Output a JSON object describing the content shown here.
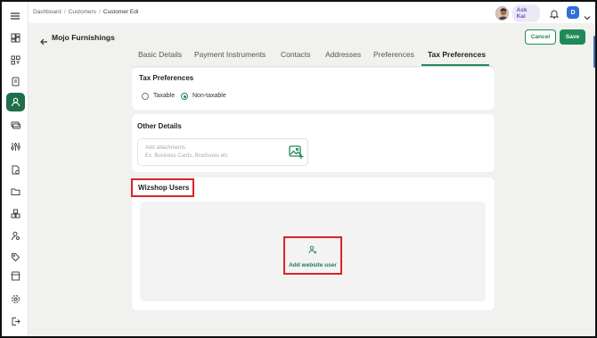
{
  "breadcrumb": [
    "Dashboard",
    "Customers",
    "Customer Edi"
  ],
  "header": {
    "ask_kai": "Ask Kai",
    "user_initial": "D"
  },
  "page": {
    "title": "Mojo Furnishings",
    "cancel_label": "Cancel",
    "save_label": "Save"
  },
  "tabs": [
    {
      "label": "Basic Details",
      "active": false
    },
    {
      "label": "Payment Instruments",
      "active": false
    },
    {
      "label": "Contacts",
      "active": false
    },
    {
      "label": "Addresses",
      "active": false
    },
    {
      "label": "Preferences",
      "active": false
    },
    {
      "label": "Tax Preferences",
      "active": true
    }
  ],
  "tax_preferences": {
    "title": "Tax Preferences",
    "options": [
      {
        "label": "Taxable",
        "selected": false
      },
      {
        "label": "Non-taxable",
        "selected": true
      }
    ]
  },
  "other_details": {
    "title": "Other Details",
    "attach_placeholder": "Add attachments",
    "attach_hint": "Ex: Business Cards, Brochures etc"
  },
  "wizshop_users": {
    "title": "Wizshop Users",
    "add_label": "Add website user"
  },
  "sidebar_icons": [
    "menu-icon",
    "dashboard-icon",
    "scan-icon",
    "document-icon",
    "user-icon",
    "payments-icon",
    "settings-sliders-icon",
    "invoice-icon",
    "folder-icon",
    "boxes-icon",
    "user-settings-icon",
    "tag-icon",
    "store-icon",
    "gear-icon",
    "logout-icon"
  ],
  "colors": {
    "brand_green": "#1e8a59",
    "highlight_red": "#d8232a",
    "kai_purple": "#6b57b8",
    "user_blue": "#2f6fd6"
  }
}
